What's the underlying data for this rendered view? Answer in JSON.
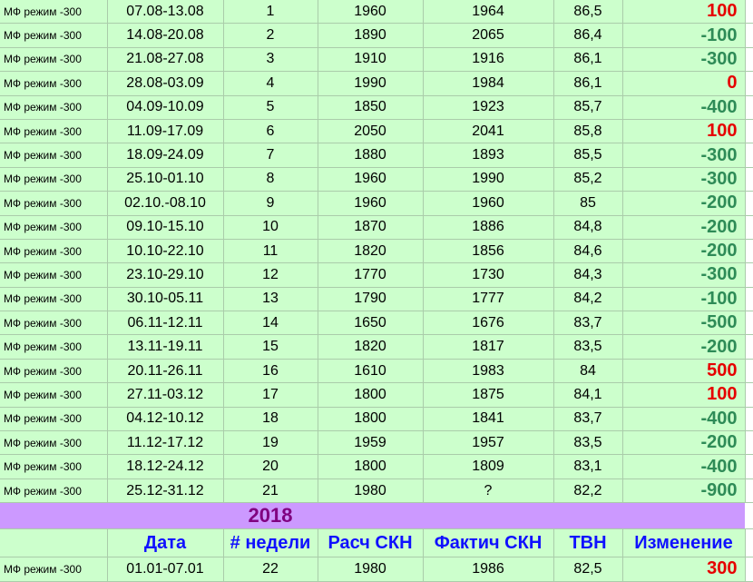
{
  "rows_2017": [
    {
      "mode": "МФ режим -300",
      "date": "07.08-13.08",
      "week": "1",
      "calc": "1960",
      "fact": "1964",
      "tvn": "86,5",
      "change": "100",
      "sign": "pos"
    },
    {
      "mode": "МФ режим -300",
      "date": "14.08-20.08",
      "week": "2",
      "calc": "1890",
      "fact": "2065",
      "tvn": "86,4",
      "change": "-100",
      "sign": "neg"
    },
    {
      "mode": "МФ режим -300",
      "date": "21.08-27.08",
      "week": "3",
      "calc": "1910",
      "fact": "1916",
      "tvn": "86,1",
      "change": "-300",
      "sign": "neg"
    },
    {
      "mode": "МФ режим -300",
      "date": "28.08-03.09",
      "week": "4",
      "calc": "1990",
      "fact": "1984",
      "tvn": "86,1",
      "change": "0",
      "sign": "zero"
    },
    {
      "mode": "МФ режим -300",
      "date": "04.09-10.09",
      "week": "5",
      "calc": "1850",
      "fact": "1923",
      "tvn": "85,7",
      "change": "-400",
      "sign": "neg"
    },
    {
      "mode": "МФ режим -300",
      "date": "11.09-17.09",
      "week": "6",
      "calc": "2050",
      "fact": "2041",
      "tvn": "85,8",
      "change": "100",
      "sign": "pos"
    },
    {
      "mode": "МФ режим -300",
      "date": "18.09-24.09",
      "week": "7",
      "calc": "1880",
      "fact": "1893",
      "tvn": "85,5",
      "change": "-300",
      "sign": "neg"
    },
    {
      "mode": "МФ режим -300",
      "date": "25.10-01.10",
      "week": "8",
      "calc": "1960",
      "fact": "1990",
      "tvn": "85,2",
      "change": "-300",
      "sign": "neg"
    },
    {
      "mode": "МФ режим -300",
      "date": "02.10.-08.10",
      "week": "9",
      "calc": "1960",
      "fact": "1960",
      "tvn": "85",
      "change": "-200",
      "sign": "neg"
    },
    {
      "mode": "МФ режим -300",
      "date": "09.10-15.10",
      "week": "10",
      "calc": "1870",
      "fact": "1886",
      "tvn": "84,8",
      "change": "-200",
      "sign": "neg"
    },
    {
      "mode": "МФ режим -300",
      "date": "10.10-22.10",
      "week": "11",
      "calc": "1820",
      "fact": "1856",
      "tvn": "84,6",
      "change": "-200",
      "sign": "neg"
    },
    {
      "mode": "МФ режим -300",
      "date": "23.10-29.10",
      "week": "12",
      "calc": "1770",
      "fact": "1730",
      "tvn": "84,3",
      "change": "-300",
      "sign": "neg"
    },
    {
      "mode": "МФ режим -300",
      "date": "30.10-05.11",
      "week": "13",
      "calc": "1790",
      "fact": "1777",
      "tvn": "84,2",
      "change": "-100",
      "sign": "neg"
    },
    {
      "mode": "МФ режим -300",
      "date": "06.11-12.11",
      "week": "14",
      "calc": "1650",
      "fact": "1676",
      "tvn": "83,7",
      "change": "-500",
      "sign": "neg"
    },
    {
      "mode": "МФ режим -300",
      "date": "13.11-19.11",
      "week": "15",
      "calc": "1820",
      "fact": "1817",
      "tvn": "83,5",
      "change": "-200",
      "sign": "neg"
    },
    {
      "mode": "МФ режим -300",
      "date": "20.11-26.11",
      "week": "16",
      "calc": "1610",
      "fact": "1983",
      "tvn": "84",
      "change": "500",
      "sign": "pos"
    },
    {
      "mode": "МФ режим -300",
      "date": "27.11-03.12",
      "week": "17",
      "calc": "1800",
      "fact": "1875",
      "tvn": "84,1",
      "change": "100",
      "sign": "pos"
    },
    {
      "mode": "МФ режим -300",
      "date": "04.12-10.12",
      "week": "18",
      "calc": "1800",
      "fact": "1841",
      "tvn": "83,7",
      "change": "-400",
      "sign": "neg"
    },
    {
      "mode": "МФ режим -300",
      "date": "11.12-17.12",
      "week": "19",
      "calc": "1959",
      "fact": "1957",
      "tvn": "83,5",
      "change": "-200",
      "sign": "neg"
    },
    {
      "mode": "МФ режим -300",
      "date": "18.12-24.12",
      "week": "20",
      "calc": "1800",
      "fact": "1809",
      "tvn": "83,1",
      "change": "-400",
      "sign": "neg"
    },
    {
      "mode": "МФ режим -300",
      "date": "25.12-31.12",
      "week": "21",
      "calc": "1980",
      "fact": "?",
      "tvn": "82,2",
      "change": "-900",
      "sign": "neg"
    }
  ],
  "year_label": "2018",
  "headers": {
    "date": "Дата",
    "week": "# недели",
    "calc": "Расч СКН",
    "fact": "Фактич СКН",
    "tvn": "ТВН",
    "change": "Изменение"
  },
  "rows_2018": [
    {
      "mode": "МФ режим -300",
      "date": "01.01-07.01",
      "week": "22",
      "calc": "1980",
      "fact": "1986",
      "tvn": "82,5",
      "change": "300",
      "sign": "pos"
    }
  ],
  "colors": {
    "row_bg": "#ccffcc",
    "year_band": "#cc99ff",
    "year_text": "#800080",
    "header_text": "#1010ff",
    "positive": "#e60000",
    "negative": "#2e8b57"
  }
}
